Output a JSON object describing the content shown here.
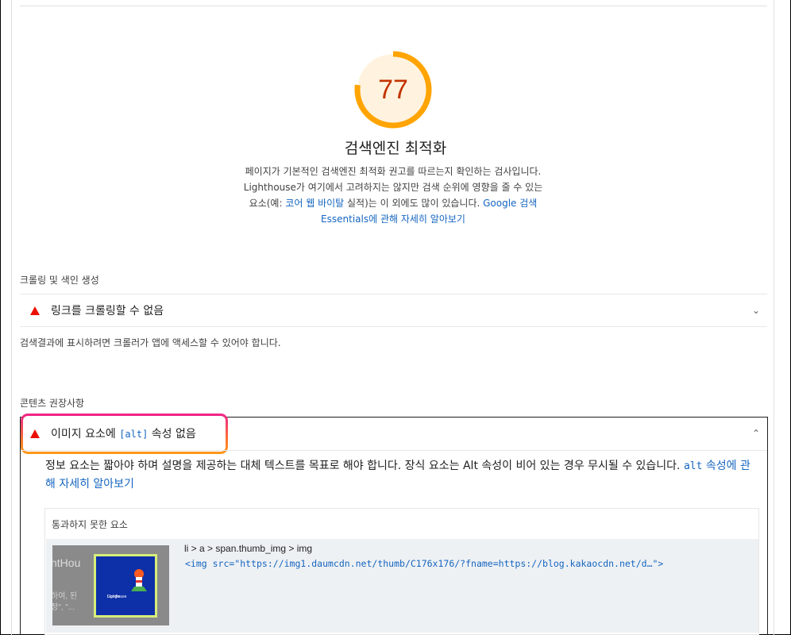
{
  "score": {
    "value": "77",
    "fraction": 0.77,
    "color": "#ffa400",
    "track_color": "#fff3e0",
    "text_color": "#c33300"
  },
  "category": {
    "title": "검색엔진 최적화",
    "desc_line1": "페이지가 기본적인 검색엔진 최적화 권고를 따르는지 확인하는 검사입니다.",
    "desc_line2": "Lighthouse가 여기에서 고려하지는 않지만 검색 순위에 영향을 줄 수 있는",
    "desc_line3_a": "요소(예: ",
    "desc_line3_link": "코어 웹 바이탈",
    "desc_line3_b": " 실적)는 이 외에도 많이 있습니다. ",
    "desc_line3_link2": "Google 검색",
    "desc_line4_link": "Essentials에 관해 자세히 알아보기"
  },
  "groups": {
    "crawl": {
      "title": "크롤링 및 색인 생성",
      "audit_title": "링크를 크롤링할 수 없음",
      "hint": "검색결과에 표시하려면 크롤러가 앱에 액세스할 수 있어야 합니다."
    },
    "content": {
      "title": "콘텐츠 권장사항",
      "audit_title_pre": "이미지 요소에 ",
      "audit_title_code": "[alt]",
      "audit_title_post": " 속성 없음",
      "desc": "정보 요소는 짧아야 하며 설명을 제공하는 대체 텍스트를 목표로 해야 합니다. 장식 요소는 Alt 속성이 비어 있는 경우 무시될 수 있습니다. ",
      "desc_link_code": "alt",
      "desc_link_text": " 속성에 관해 자세히 알아보기",
      "table_header": "통과하지 못한 요소",
      "item_selector": "li > a > span.thumb_img > img",
      "item_snippet": "<img src=\"https://img1.daumcdn.net/thumb/C176x176/?fname=https://blog.kakaocdn.net/d…\">",
      "thumb_bg_text": "htHou",
      "thumb_bg_text2a": "하여, 된",
      "thumb_bg_text2b": "정\", \"...",
      "thumb_img_text_a": "Google",
      "thumb_img_text_b": "Lighthouse"
    }
  },
  "icons": {
    "fail": "triangle-fail-icon",
    "chevron_down": "chevron-down-icon",
    "chevron_up": "chevron-up-icon"
  },
  "colors": {
    "fail": "#eb0f00",
    "link": "#1565c0",
    "highlight_top": "#f0218a",
    "highlight_bottom": "#ff9a1a"
  }
}
